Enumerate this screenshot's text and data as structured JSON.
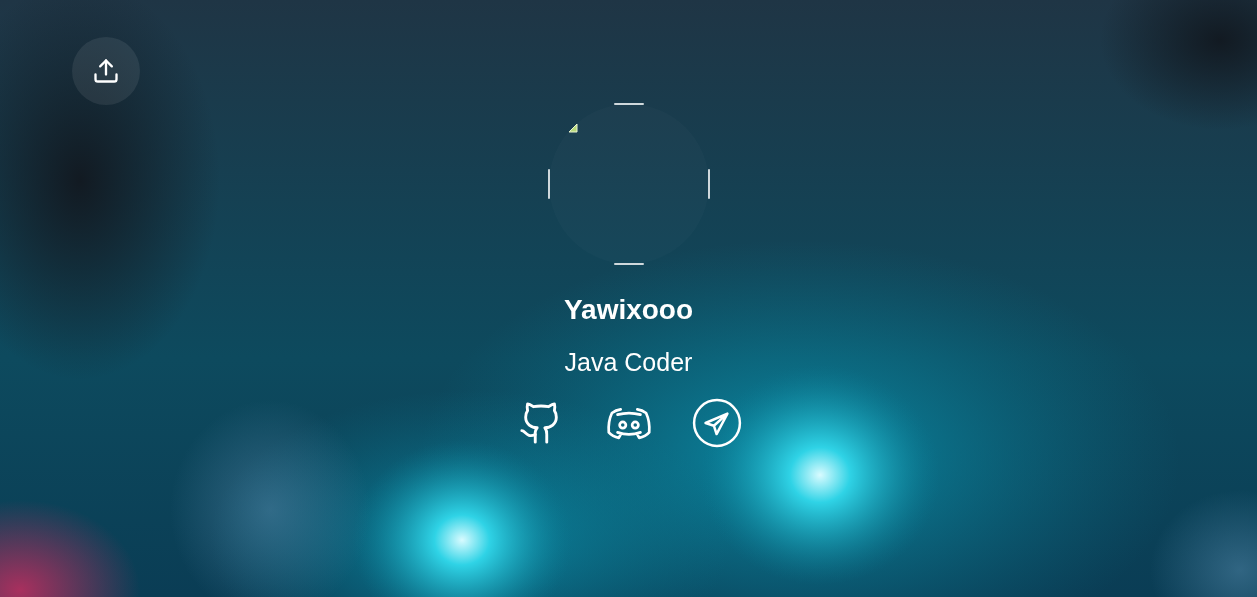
{
  "profile": {
    "name": "Yawixooo",
    "tagline": "Java Coder"
  },
  "social_links": [
    {
      "kind": "github"
    },
    {
      "kind": "discord"
    },
    {
      "kind": "telegram"
    }
  ]
}
